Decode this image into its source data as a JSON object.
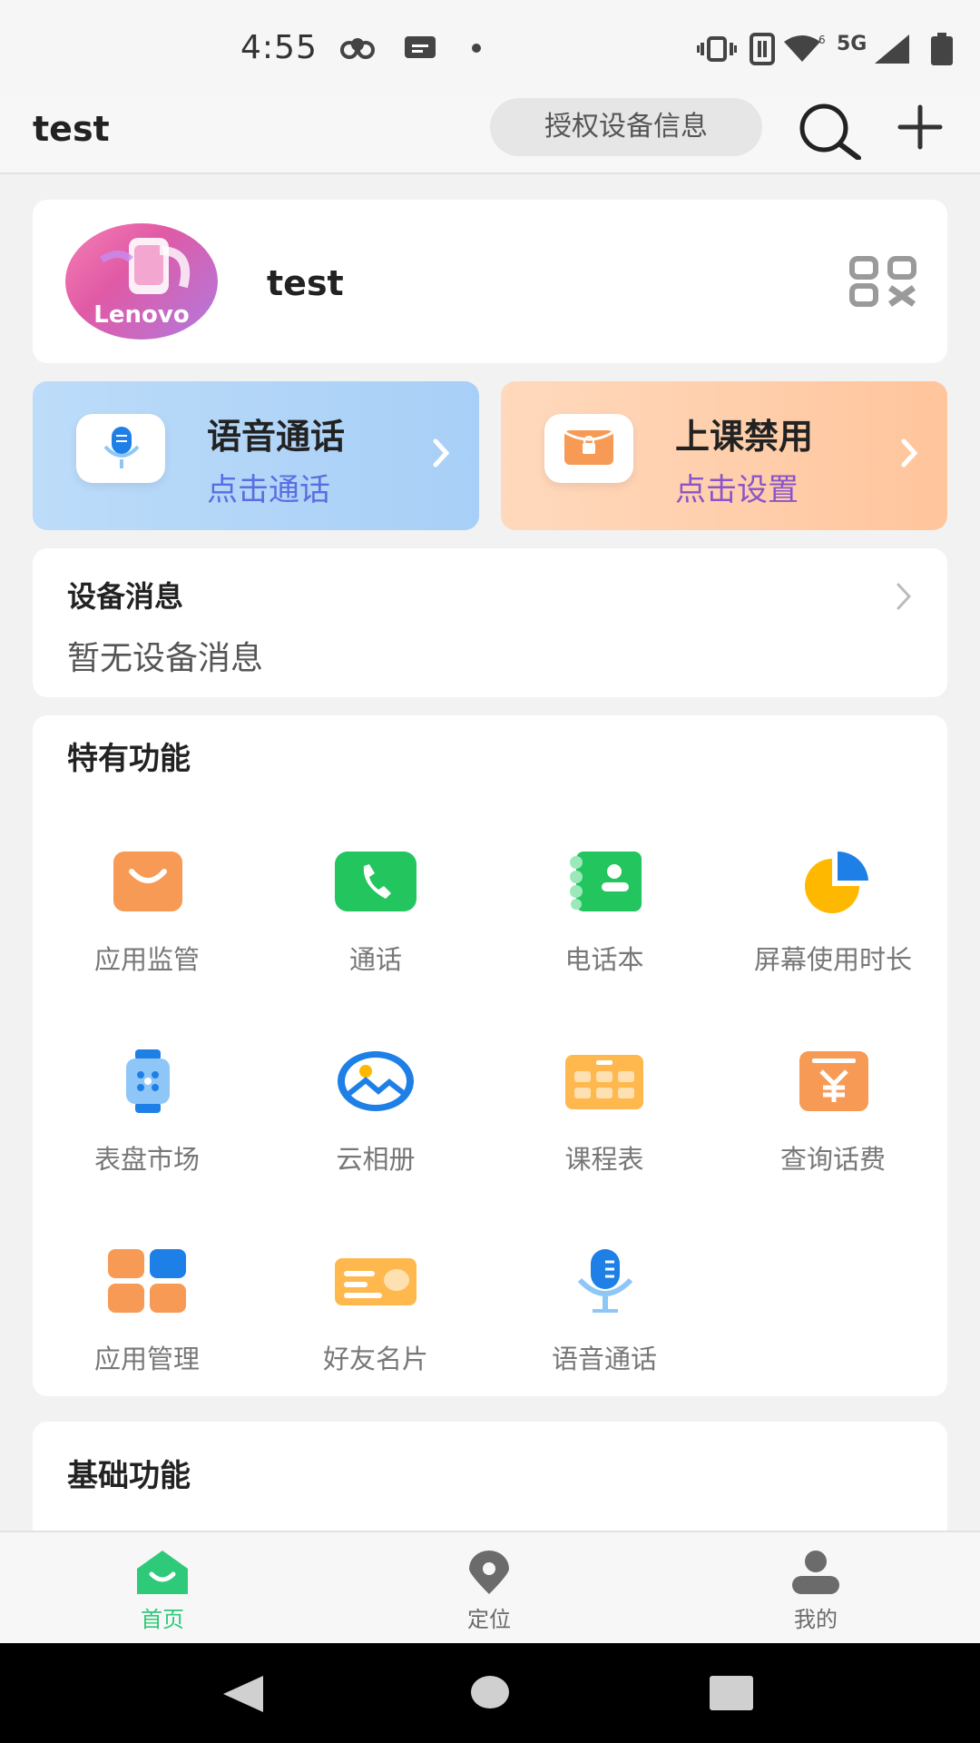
{
  "status_bar": {
    "time": "4:55",
    "network": "5G"
  },
  "header": {
    "title": "test",
    "auth_button": "授权设备信息"
  },
  "profile": {
    "name": "test",
    "avatar_brand": "Lenovo"
  },
  "actions": [
    {
      "title": "语音通话",
      "subtitle": "点击通话"
    },
    {
      "title": "上课禁用",
      "subtitle": "点击设置"
    }
  ],
  "device_messages": {
    "title": "设备消息",
    "body": "暂无设备消息"
  },
  "special_features": {
    "title": "特有功能",
    "items": [
      {
        "label": "应用监管",
        "icon": "shopping-bag-icon"
      },
      {
        "label": "通话",
        "icon": "phone-icon"
      },
      {
        "label": "电话本",
        "icon": "contacts-book-icon"
      },
      {
        "label": "屏幕使用时长",
        "icon": "pie-chart-icon"
      },
      {
        "label": "表盘市场",
        "icon": "watch-icon"
      },
      {
        "label": "云相册",
        "icon": "photo-icon"
      },
      {
        "label": "课程表",
        "icon": "schedule-icon"
      },
      {
        "label": "查询话费",
        "icon": "yuan-icon"
      },
      {
        "label": "应用管理",
        "icon": "app-grid-icon"
      },
      {
        "label": "好友名片",
        "icon": "id-card-icon"
      },
      {
        "label": "语音通话",
        "icon": "microphone-icon"
      }
    ]
  },
  "basic_features": {
    "title": "基础功能"
  },
  "tabs": [
    {
      "label": "首页",
      "active": true
    },
    {
      "label": "定位",
      "active": false
    },
    {
      "label": "我的",
      "active": false
    }
  ],
  "colors": {
    "accent_green": "#2fc97a",
    "inactive_gray": "#6b6b6b"
  }
}
